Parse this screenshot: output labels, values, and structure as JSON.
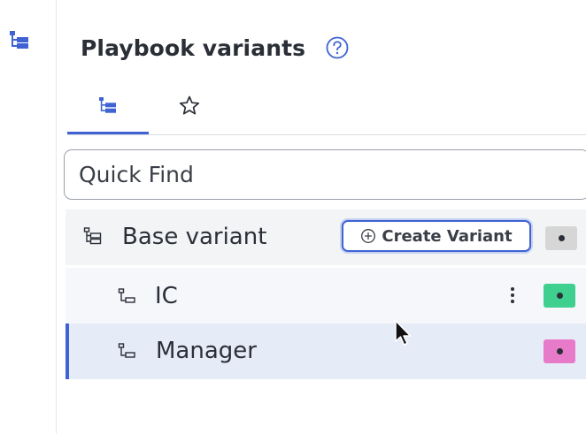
{
  "panel": {
    "title": "Playbook variants",
    "help_icon": "question-circle-icon"
  },
  "rail": {
    "icon": "variant-tree-icon"
  },
  "tabs": [
    {
      "icon": "variant-tree-icon",
      "active": true
    },
    {
      "icon": "star-icon",
      "active": false
    }
  ],
  "search": {
    "placeholder": "Quick Find",
    "value": ""
  },
  "variants": [
    {
      "label": "Base variant",
      "icon": "variant-tree-icon",
      "action_label": "Create Variant",
      "action_icon": "plus-circle-icon",
      "color": "#d6d6d6"
    },
    {
      "label": "IC",
      "icon": "sub-variant-icon",
      "menu_icon": "kebab-menu-icon",
      "color": "#3fd08f"
    },
    {
      "label": "Manager",
      "icon": "sub-variant-icon",
      "selected": true,
      "color": "#e77ac9"
    }
  ],
  "colors": {
    "accent": "#3f63d3",
    "selected_row": "#e6ebf8"
  }
}
